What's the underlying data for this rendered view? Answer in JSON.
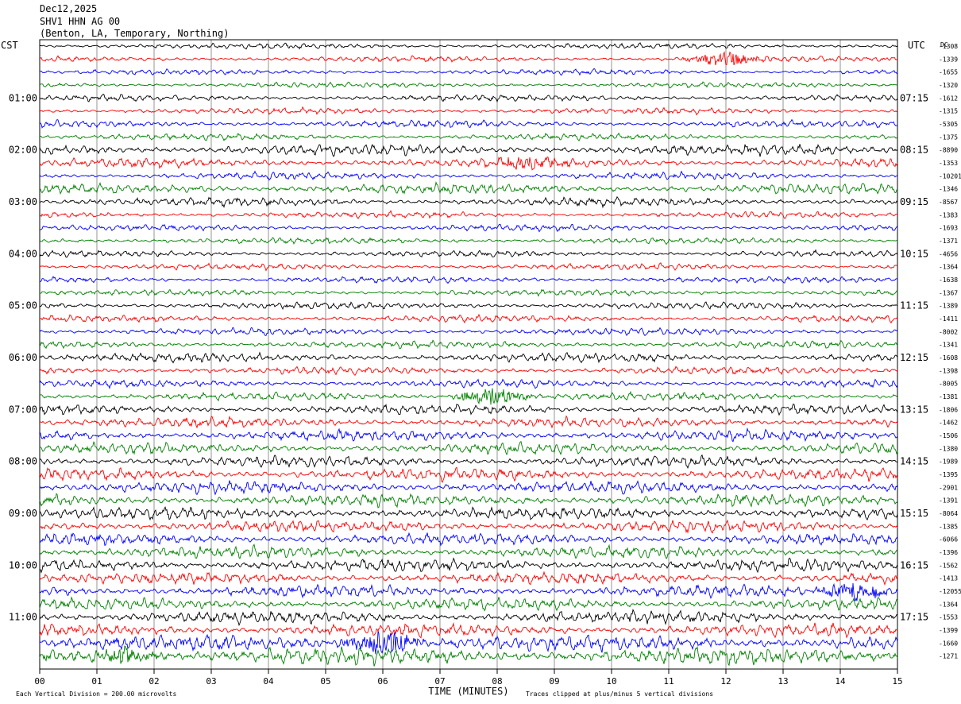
{
  "header": {
    "date": "Dec12,2025",
    "station": "SHV1 HHN AG 00",
    "location": "(Benton, LA, Temporary, Northing)"
  },
  "axes": {
    "left_zone": "CST",
    "right_zone": "UTC",
    "dc_label": "DC",
    "x_title": "TIME (MINUTES)",
    "footer_left": "Each Vertical Division =  200.00 microvolts",
    "footer_right": "Traces clipped at plus/minus 5 vertical divisions"
  },
  "chart_data": {
    "type": "line",
    "title": "SHV1 HHN AG 00",
    "xlabel": "TIME (MINUTES)",
    "ylabel": "",
    "xlim": [
      0,
      15
    ],
    "x_ticks": [
      "00",
      "01",
      "02",
      "03",
      "04",
      "05",
      "06",
      "07",
      "08",
      "09",
      "10",
      "11",
      "12",
      "13",
      "14",
      "15"
    ],
    "left_time_labels": [
      "01:00",
      "02:00",
      "03:00",
      "04:00",
      "05:00",
      "06:00",
      "07:00",
      "08:00",
      "09:00",
      "10:00",
      "11:00"
    ],
    "right_time_labels": [
      "07:15",
      "08:15",
      "09:15",
      "10:15",
      "11:15",
      "12:15",
      "13:15",
      "14:15",
      "15:15",
      "16:15",
      "17:15"
    ],
    "label_every_n_traces": 4,
    "label_first_trace_index": 4,
    "trace_colors": [
      "#000000",
      "#ff0000",
      "#0000ff",
      "#008000"
    ],
    "dc_offsets": [
      "-1308",
      "-1339",
      "-1655",
      "-1320",
      "-1612",
      "-1315",
      "-5305",
      "-1375",
      "-8890",
      "-1353",
      "-10201",
      "-1346",
      "-8567",
      "-1383",
      "-1693",
      "-1371",
      "-4656",
      "-1364",
      "-1638",
      "-1367",
      "-1389",
      "-1411",
      "-8002",
      "-1341",
      "-1608",
      "-1398",
      "-8005",
      "-1381",
      "-1806",
      "-1462",
      "-1506",
      "-1380",
      "-1989",
      "-1395",
      "-2901",
      "-1391",
      "-8064",
      "-1385",
      "-6066",
      "-1396",
      "-1562",
      "-1413",
      "-12055",
      "-1364",
      "-1553",
      "-1399",
      "-1660",
      "-1271"
    ],
    "trace_amplitude_divisions": [
      0.7,
      0.7,
      0.7,
      0.7,
      0.8,
      0.8,
      0.9,
      0.8,
      1.4,
      1.2,
      0.9,
      1.3,
      1.1,
      0.8,
      0.8,
      0.8,
      0.8,
      0.8,
      0.8,
      0.8,
      0.9,
      0.9,
      0.9,
      0.9,
      1.2,
      1.0,
      1.0,
      1.0,
      1.2,
      1.3,
      1.4,
      1.4,
      1.4,
      1.5,
      1.5,
      1.5,
      1.6,
      1.5,
      1.5,
      1.5,
      1.6,
      1.5,
      1.5,
      1.5,
      1.6,
      1.6,
      2.0,
      2.2
    ],
    "events": [
      {
        "trace": 1,
        "minute": 12.0,
        "amplitude_divisions": 2.5
      },
      {
        "trace": 9,
        "minute": 8.5,
        "amplitude_divisions": 2.0
      },
      {
        "trace": 27,
        "minute": 7.9,
        "amplitude_divisions": 3.0
      },
      {
        "trace": 42,
        "minute": 14.3,
        "amplitude_divisions": 3.0
      },
      {
        "trace": 46,
        "minute": 6.0,
        "amplitude_divisions": 4.5
      },
      {
        "trace": 47,
        "minute": 1.5,
        "amplitude_divisions": 2.5
      }
    ],
    "division_microvolts": 200.0,
    "clip_divisions": 5
  }
}
